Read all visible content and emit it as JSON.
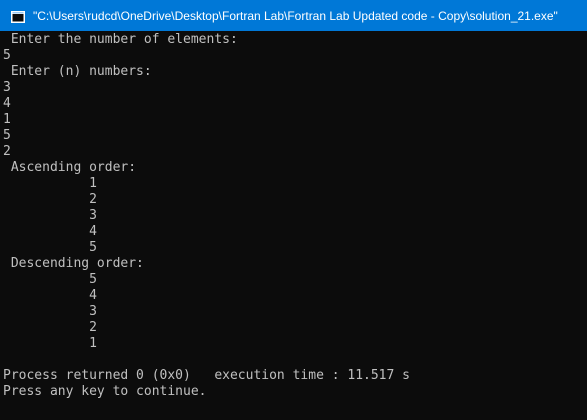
{
  "window": {
    "title": "\"C:\\Users\\rudcd\\OneDrive\\Desktop\\Fortran Lab\\Fortran Lab Updated code - Copy\\solution_21.exe\"",
    "icon": "console-app-icon",
    "titlebar_color": "#0078d7",
    "console_bg": "#0c0c0c",
    "console_fg": "#c0c0c0"
  },
  "console": {
    "lines": [
      " Enter the number of elements:",
      "5",
      " Enter (n) numbers:",
      "3",
      "4",
      "1",
      "5",
      "2",
      " Ascending order:",
      "           1",
      "           2",
      "           3",
      "           4",
      "           5",
      " Descending order:",
      "           5",
      "           4",
      "           3",
      "           2",
      "           1",
      "",
      "Process returned 0 (0x0)   execution time : 11.517 s",
      "Press any key to continue."
    ]
  }
}
